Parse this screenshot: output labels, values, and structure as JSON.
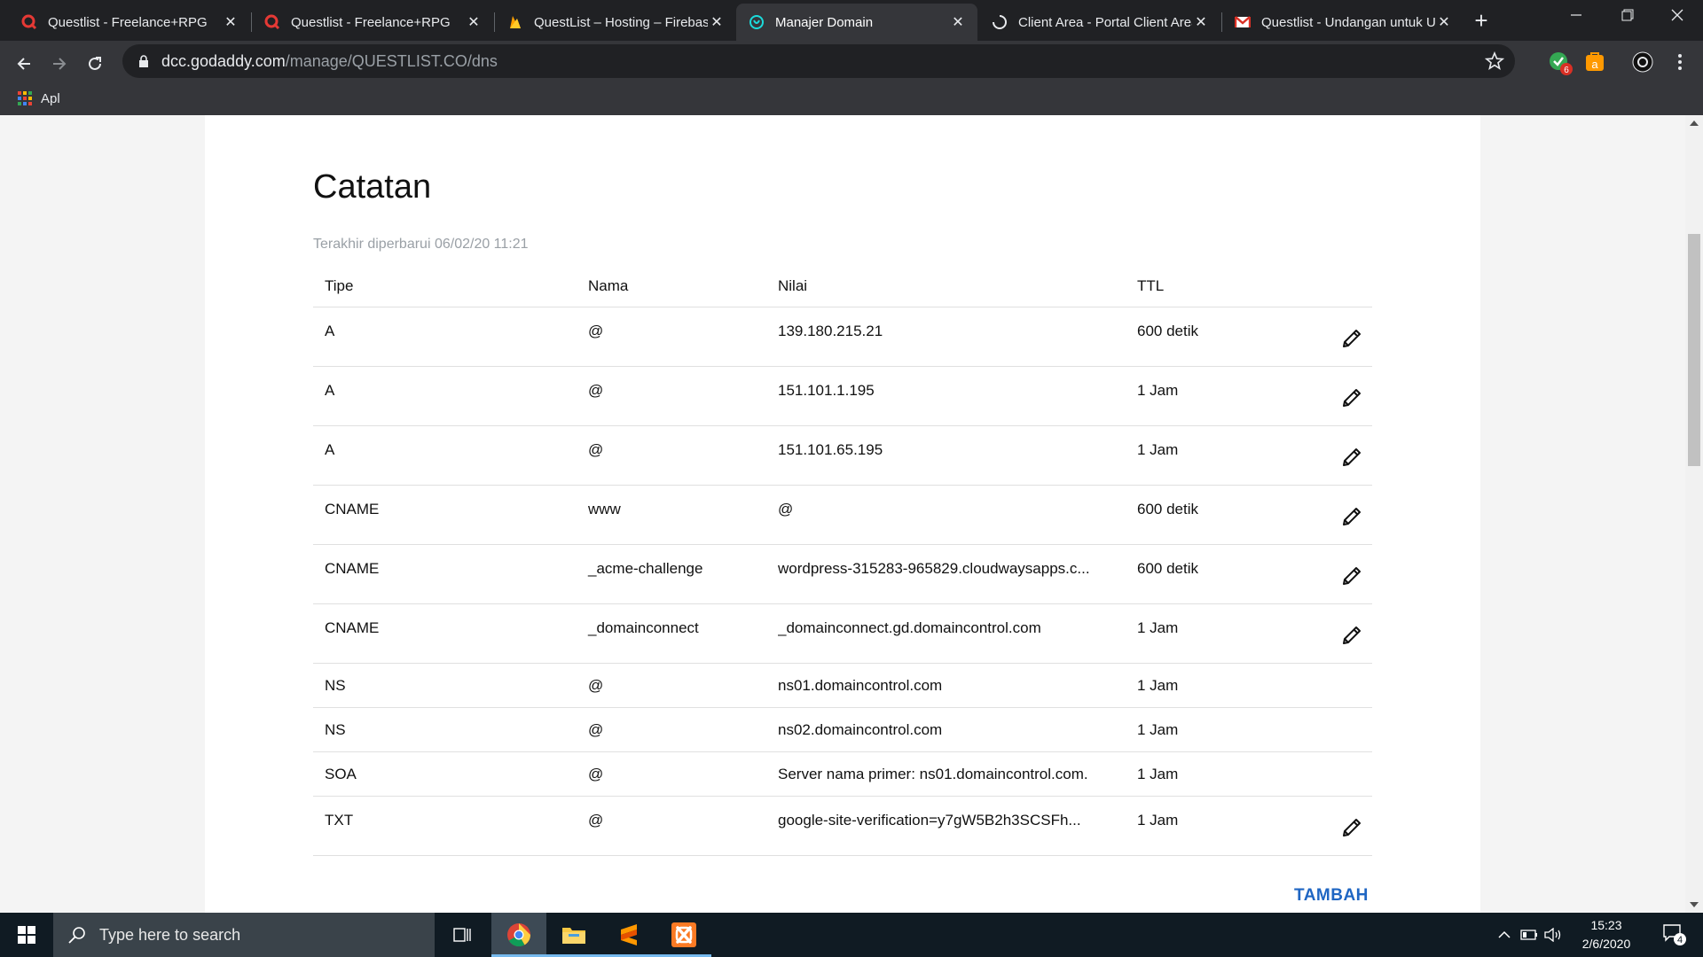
{
  "browser": {
    "tabs": [
      {
        "title": "Questlist - Freelance+RPG",
        "icon": "questlist-icon",
        "active": false
      },
      {
        "title": "Questlist - Freelance+RPG",
        "icon": "questlist-icon",
        "active": false
      },
      {
        "title": "QuestList – Hosting – Firebase",
        "icon": "firebase-icon",
        "active": false
      },
      {
        "title": "Manajer Domain",
        "icon": "godaddy-icon",
        "active": true
      },
      {
        "title": "Client Area - Portal Client Area",
        "icon": "loading-icon",
        "active": false
      },
      {
        "title": "Questlist - Undangan untuk Us",
        "icon": "gmail-icon",
        "active": false
      }
    ],
    "url_host": "dcc.godaddy.com",
    "url_path": "/manage/QUESTLIST.CO/dns",
    "bookmark_apps_label": "Apl",
    "extension_badge": "6"
  },
  "page": {
    "title": "Catatan",
    "last_updated": "Terakhir diperbarui 06/02/20 11:21",
    "columns": {
      "type": "Tipe",
      "name": "Nama",
      "value": "Nilai",
      "ttl": "TTL"
    },
    "records": [
      {
        "type": "A",
        "name": "@",
        "value": "139.180.215.21",
        "ttl": "600 detik",
        "editable": true
      },
      {
        "type": "A",
        "name": "@",
        "value": "151.101.1.195",
        "ttl": "1 Jam",
        "editable": true
      },
      {
        "type": "A",
        "name": "@",
        "value": "151.101.65.195",
        "ttl": "1 Jam",
        "editable": true
      },
      {
        "type": "CNAME",
        "name": "www",
        "value": "@",
        "ttl": "600 detik",
        "editable": true
      },
      {
        "type": "CNAME",
        "name": "_acme-challenge",
        "value": "wordpress-315283-965829.cloudwaysapps.c...",
        "ttl": "600 detik",
        "editable": true
      },
      {
        "type": "CNAME",
        "name": "_domainconnect",
        "value": "_domainconnect.gd.domaincontrol.com",
        "ttl": "1 Jam",
        "editable": true
      },
      {
        "type": "NS",
        "name": "@",
        "value": "ns01.domaincontrol.com",
        "ttl": "1 Jam",
        "editable": false
      },
      {
        "type": "NS",
        "name": "@",
        "value": "ns02.domaincontrol.com",
        "ttl": "1 Jam",
        "editable": false
      },
      {
        "type": "SOA",
        "name": "@",
        "value": "Server nama primer: ns01.domaincontrol.com.",
        "ttl": "1 Jam",
        "editable": false
      },
      {
        "type": "TXT",
        "name": "@",
        "value": "google-site-verification=y7gW5B2h3SCSFh...",
        "ttl": "1 Jam",
        "editable": true
      }
    ],
    "add_label": "TAMBAH"
  },
  "taskbar": {
    "search_placeholder": "Type here to search",
    "time": "15:23",
    "date": "2/6/2020",
    "notification_count": "4"
  },
  "colors": {
    "accent": "#1f66c3",
    "chrome_dark": "#202124",
    "chrome_toolbar": "#35363a",
    "taskbar": "#101b23"
  }
}
